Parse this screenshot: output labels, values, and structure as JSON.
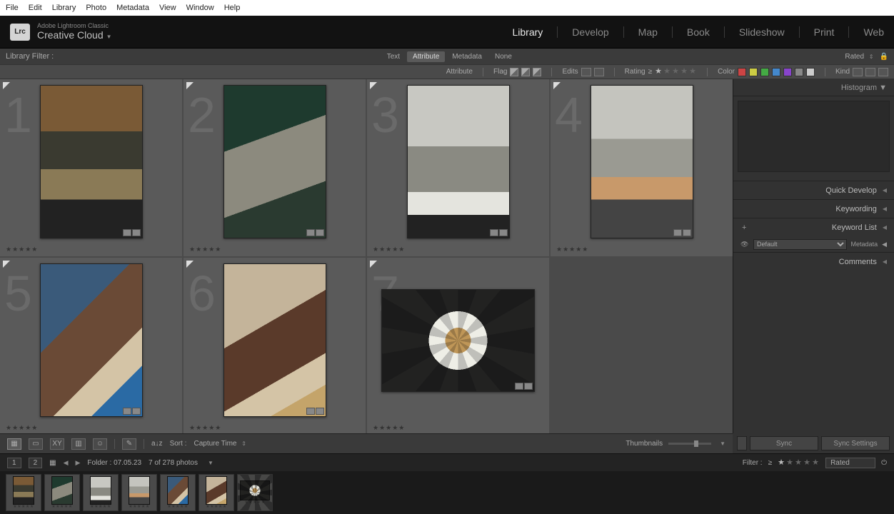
{
  "os_menu": [
    "File",
    "Edit",
    "Library",
    "Photo",
    "Metadata",
    "View",
    "Window",
    "Help"
  ],
  "app": {
    "subtitle": "Adobe Lightroom Classic",
    "title": "Creative Cloud",
    "logo": "Lrc"
  },
  "modules": [
    "Library",
    "Develop",
    "Map",
    "Book",
    "Slideshow",
    "Print",
    "Web"
  ],
  "active_module": "Library",
  "filter_bar": {
    "label": "Library Filter :",
    "tabs": [
      "Text",
      "Attribute",
      "Metadata",
      "None"
    ],
    "active": "Attribute",
    "preset": "Rated"
  },
  "attr_bar": {
    "attribute": "Attribute",
    "flag": "Flag",
    "edits": "Edits",
    "rating": "Rating",
    "rating_op": "≥",
    "color": "Color",
    "kind": "Kind",
    "colors": [
      "#c44",
      "#cc4",
      "#4a4",
      "#48c",
      "#84c",
      "#888",
      "#ccc"
    ]
  },
  "cells": [
    {
      "num": "1",
      "orient": "portrait",
      "ph": "ph1"
    },
    {
      "num": "2",
      "orient": "portrait",
      "ph": "ph2"
    },
    {
      "num": "3",
      "orient": "portrait",
      "ph": "ph3"
    },
    {
      "num": "4",
      "orient": "portrait",
      "ph": "ph4"
    },
    {
      "num": "5",
      "orient": "portrait",
      "ph": "ph5"
    },
    {
      "num": "6",
      "orient": "portrait",
      "ph": "ph6"
    },
    {
      "num": "7",
      "orient": "landscape",
      "ph": "ph7"
    }
  ],
  "right_panel": {
    "histogram": "Histogram",
    "quick_develop": "Quick Develop",
    "keywording": "Keywording",
    "keyword_list": "Keyword List",
    "metadata": "Metadata",
    "metadata_preset": "Default",
    "comments": "Comments"
  },
  "grid_toolbar": {
    "sort_label": "Sort :",
    "sort_value": "Capture Time",
    "thumbnails": "Thumbnails"
  },
  "sync": {
    "sync": "Sync",
    "sync_settings": "Sync Settings"
  },
  "status": {
    "page1": "1",
    "page2": "2",
    "folder": "Folder : 07.05.23",
    "count": "7 of 278 photos",
    "filter_label": "Filter :",
    "filter_op": "≥",
    "preset": "Rated"
  },
  "rating_placeholder": "★★★★★"
}
